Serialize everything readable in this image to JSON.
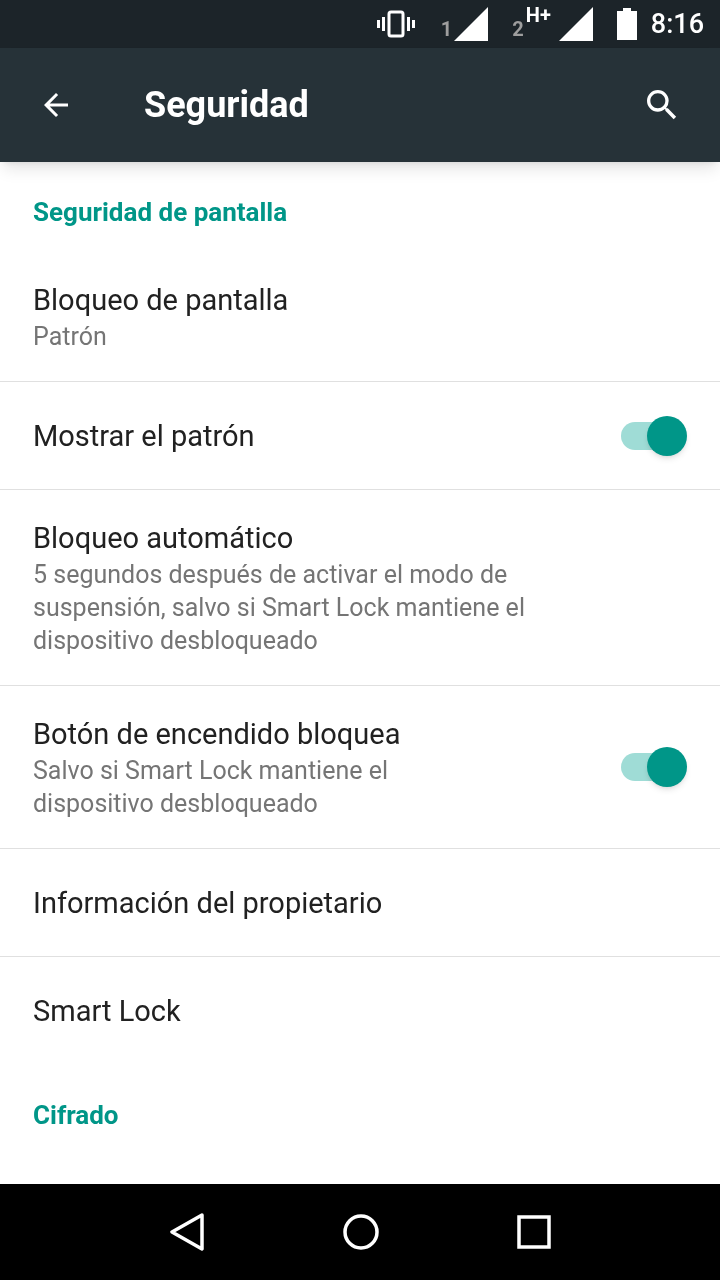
{
  "status_bar": {
    "sim_1": "1",
    "sim_2": "2",
    "network_type": "H+",
    "time": "8:16"
  },
  "app_bar": {
    "title": "Seguridad"
  },
  "sections": [
    {
      "header": "Seguridad de pantalla",
      "items": [
        {
          "title": "Bloqueo de pantalla",
          "subtitle": "Patrón",
          "divider": true
        },
        {
          "title": "Mostrar el patrón",
          "switch": {
            "on": true
          },
          "divider": true
        },
        {
          "title": "Bloqueo automático",
          "subtitle": "5 segundos después de activar el modo de suspensión, salvo si Smart Lock mantiene el dispositivo desbloqueado",
          "divider": true
        },
        {
          "title": "Botón de encendido bloquea",
          "subtitle": "Salvo si Smart Lock mantiene el dispositivo desbloqueado",
          "switch": {
            "on": true
          },
          "divider": true
        },
        {
          "title": "Información del propietario",
          "divider": true
        },
        {
          "title": "Smart Lock",
          "divider": false
        }
      ]
    },
    {
      "header": "Cifrado"
    }
  ]
}
